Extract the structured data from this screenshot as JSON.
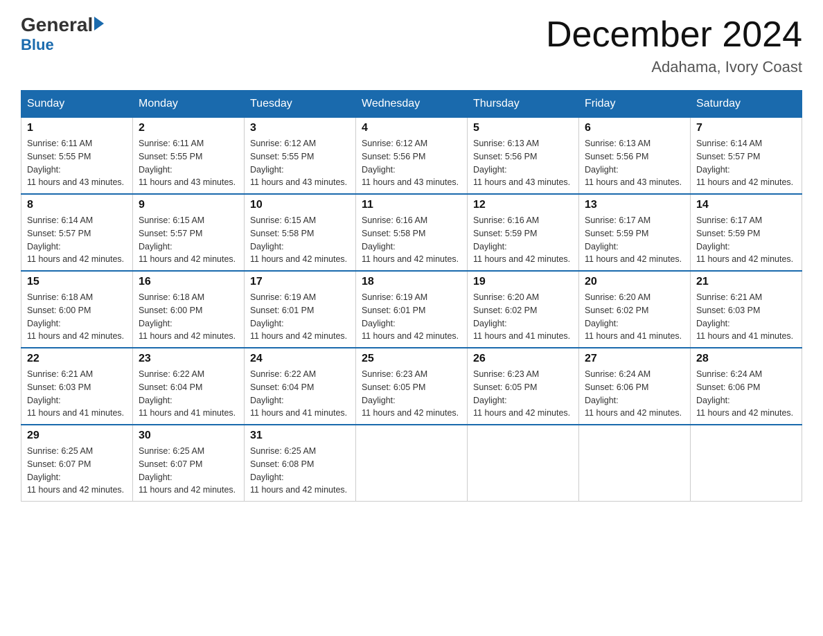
{
  "logo": {
    "general": "General",
    "blue": "Blue",
    "subtitle": "Blue"
  },
  "header": {
    "month_title": "December 2024",
    "location": "Adahama, Ivory Coast"
  },
  "weekdays": [
    "Sunday",
    "Monday",
    "Tuesday",
    "Wednesday",
    "Thursday",
    "Friday",
    "Saturday"
  ],
  "weeks": [
    [
      {
        "day": "1",
        "sunrise": "6:11 AM",
        "sunset": "5:55 PM",
        "daylight": "11 hours and 43 minutes."
      },
      {
        "day": "2",
        "sunrise": "6:11 AM",
        "sunset": "5:55 PM",
        "daylight": "11 hours and 43 minutes."
      },
      {
        "day": "3",
        "sunrise": "6:12 AM",
        "sunset": "5:55 PM",
        "daylight": "11 hours and 43 minutes."
      },
      {
        "day": "4",
        "sunrise": "6:12 AM",
        "sunset": "5:56 PM",
        "daylight": "11 hours and 43 minutes."
      },
      {
        "day": "5",
        "sunrise": "6:13 AM",
        "sunset": "5:56 PM",
        "daylight": "11 hours and 43 minutes."
      },
      {
        "day": "6",
        "sunrise": "6:13 AM",
        "sunset": "5:56 PM",
        "daylight": "11 hours and 43 minutes."
      },
      {
        "day": "7",
        "sunrise": "6:14 AM",
        "sunset": "5:57 PM",
        "daylight": "11 hours and 42 minutes."
      }
    ],
    [
      {
        "day": "8",
        "sunrise": "6:14 AM",
        "sunset": "5:57 PM",
        "daylight": "11 hours and 42 minutes."
      },
      {
        "day": "9",
        "sunrise": "6:15 AM",
        "sunset": "5:57 PM",
        "daylight": "11 hours and 42 minutes."
      },
      {
        "day": "10",
        "sunrise": "6:15 AM",
        "sunset": "5:58 PM",
        "daylight": "11 hours and 42 minutes."
      },
      {
        "day": "11",
        "sunrise": "6:16 AM",
        "sunset": "5:58 PM",
        "daylight": "11 hours and 42 minutes."
      },
      {
        "day": "12",
        "sunrise": "6:16 AM",
        "sunset": "5:59 PM",
        "daylight": "11 hours and 42 minutes."
      },
      {
        "day": "13",
        "sunrise": "6:17 AM",
        "sunset": "5:59 PM",
        "daylight": "11 hours and 42 minutes."
      },
      {
        "day": "14",
        "sunrise": "6:17 AM",
        "sunset": "5:59 PM",
        "daylight": "11 hours and 42 minutes."
      }
    ],
    [
      {
        "day": "15",
        "sunrise": "6:18 AM",
        "sunset": "6:00 PM",
        "daylight": "11 hours and 42 minutes."
      },
      {
        "day": "16",
        "sunrise": "6:18 AM",
        "sunset": "6:00 PM",
        "daylight": "11 hours and 42 minutes."
      },
      {
        "day": "17",
        "sunrise": "6:19 AM",
        "sunset": "6:01 PM",
        "daylight": "11 hours and 42 minutes."
      },
      {
        "day": "18",
        "sunrise": "6:19 AM",
        "sunset": "6:01 PM",
        "daylight": "11 hours and 42 minutes."
      },
      {
        "day": "19",
        "sunrise": "6:20 AM",
        "sunset": "6:02 PM",
        "daylight": "11 hours and 41 minutes."
      },
      {
        "day": "20",
        "sunrise": "6:20 AM",
        "sunset": "6:02 PM",
        "daylight": "11 hours and 41 minutes."
      },
      {
        "day": "21",
        "sunrise": "6:21 AM",
        "sunset": "6:03 PM",
        "daylight": "11 hours and 41 minutes."
      }
    ],
    [
      {
        "day": "22",
        "sunrise": "6:21 AM",
        "sunset": "6:03 PM",
        "daylight": "11 hours and 41 minutes."
      },
      {
        "day": "23",
        "sunrise": "6:22 AM",
        "sunset": "6:04 PM",
        "daylight": "11 hours and 41 minutes."
      },
      {
        "day": "24",
        "sunrise": "6:22 AM",
        "sunset": "6:04 PM",
        "daylight": "11 hours and 41 minutes."
      },
      {
        "day": "25",
        "sunrise": "6:23 AM",
        "sunset": "6:05 PM",
        "daylight": "11 hours and 42 minutes."
      },
      {
        "day": "26",
        "sunrise": "6:23 AM",
        "sunset": "6:05 PM",
        "daylight": "11 hours and 42 minutes."
      },
      {
        "day": "27",
        "sunrise": "6:24 AM",
        "sunset": "6:06 PM",
        "daylight": "11 hours and 42 minutes."
      },
      {
        "day": "28",
        "sunrise": "6:24 AM",
        "sunset": "6:06 PM",
        "daylight": "11 hours and 42 minutes."
      }
    ],
    [
      {
        "day": "29",
        "sunrise": "6:25 AM",
        "sunset": "6:07 PM",
        "daylight": "11 hours and 42 minutes."
      },
      {
        "day": "30",
        "sunrise": "6:25 AM",
        "sunset": "6:07 PM",
        "daylight": "11 hours and 42 minutes."
      },
      {
        "day": "31",
        "sunrise": "6:25 AM",
        "sunset": "6:08 PM",
        "daylight": "11 hours and 42 minutes."
      },
      null,
      null,
      null,
      null
    ]
  ],
  "labels": {
    "sunrise": "Sunrise:",
    "sunset": "Sunset:",
    "daylight": "Daylight:"
  }
}
